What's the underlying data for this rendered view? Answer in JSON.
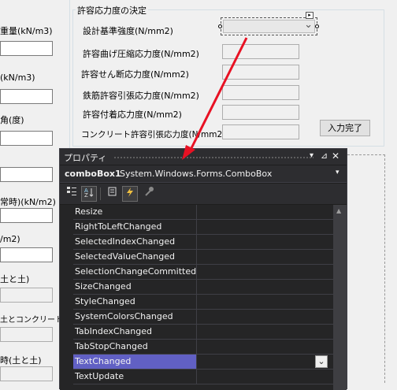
{
  "left_labels": {
    "l1": "重量(kN/m3)",
    "l2": "(kN/m3)",
    "l3": "角(度)",
    "l4": "常時)(kN/m2)",
    "l5": "/m2)",
    "l6": "土と土)",
    "l7": "土とコンクリート)",
    "l8": "時(土と土)"
  },
  "group": {
    "title": "許容応力度の決定",
    "labels": [
      "設計基準強度(N/mm2)",
      "許容曲げ圧縮応力度(N/mm2)",
      "許容せん断応力度(N/mm2)",
      "鉄筋許容引張応力度(N/mm2)",
      "許容付着応力度(N/mm2)",
      "コンクリート許容引張応力度(N/mm2)"
    ],
    "button": "入力完了"
  },
  "combo": {
    "arrow": "⌄",
    "tag": "▸"
  },
  "panel": {
    "title": "プロパティ",
    "pin": "▾",
    "pin2": "⊿",
    "close": "✕",
    "object_name": "comboBox1",
    "object_type": "System.Windows.Forms.ComboBox",
    "object_dropdown": "▾",
    "events": [
      "Resize",
      "RightToLeftChanged",
      "SelectedIndexChanged",
      "SelectedValueChanged",
      "SelectionChangeCommitted",
      "SizeChanged",
      "StyleChanged",
      "SystemColorsChanged",
      "TabIndexChanged",
      "TabStopChanged",
      "TextChanged",
      "TextUpdate"
    ],
    "selected": "TextChanged",
    "value_dropdown": "⌄",
    "scroll_up": "▲"
  },
  "colors": {
    "arrow": "#e81123",
    "selected_row": "#6160c4"
  }
}
